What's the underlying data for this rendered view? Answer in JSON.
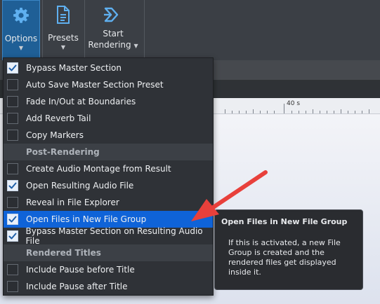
{
  "toolbar": {
    "options_label": "Options",
    "presets_label": "Presets",
    "render_label_line1": "Start",
    "render_label_line2": "Rendering",
    "options_icon": "gear-icon",
    "presets_icon": "document-icon",
    "render_icon": "render-icon"
  },
  "ruler": {
    "label": "40 s"
  },
  "menu": {
    "items": [
      {
        "label": "Bypass Master Section",
        "checked": true
      },
      {
        "label": "Auto Save Master Section Preset",
        "checked": false
      },
      {
        "label": "Fade In/Out at Boundaries",
        "checked": false
      },
      {
        "label": "Add Reverb Tail",
        "checked": false
      },
      {
        "label": "Copy Markers",
        "checked": false
      }
    ],
    "post_header": "Post-Rendering",
    "post_items": [
      {
        "label": "Create Audio Montage from Result",
        "checked": false
      },
      {
        "label": "Open Resulting Audio File",
        "checked": true
      },
      {
        "label": "Reveal in File Explorer",
        "checked": false
      },
      {
        "label": "Open Files in New File Group",
        "checked": true,
        "highlighted": true
      },
      {
        "label": "Bypass Master Section on Resulting Audio File",
        "checked": true
      }
    ],
    "titles_header": "Rendered Titles",
    "titles_items": [
      {
        "label": "Include Pause before Title",
        "checked": false
      },
      {
        "label": "Include Pause after Title",
        "checked": false
      }
    ]
  },
  "tooltip": {
    "title": "Open Files in New File Group",
    "body": "If this is activated, a new File Group is created and the rendered files get displayed inside it."
  },
  "colors": {
    "highlight": "#0f63d8",
    "arrow": "#e8403b",
    "toolbar": "#3b3f45"
  }
}
